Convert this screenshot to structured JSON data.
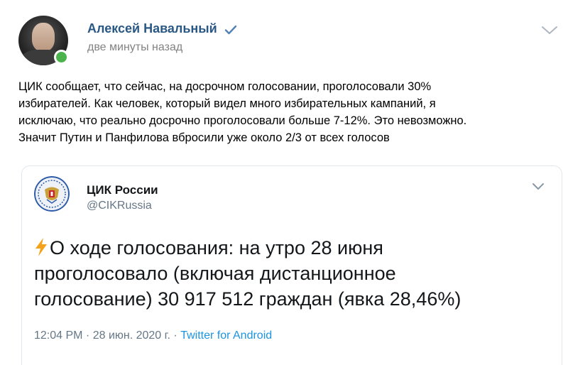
{
  "author": {
    "name": "Алексей Навальный",
    "time": "две минуты назад",
    "verified": true,
    "online": true
  },
  "post": {
    "text_lines": [
      "ЦИК сообщает, что сейчас, на досрочном голосовании, проголосовали 30%",
      "избирателей. Как человек, который видел много избирательных кампаний, я",
      "исключаю, что реально досрочно проголосовали больше 7-12%. Это невозможно.",
      "Значит Путин и Панфилова вбросили уже около 2/3 от всех голосов"
    ]
  },
  "tweet": {
    "name": "ЦИК России",
    "handle": "@CIKRussia",
    "text_lines": [
      "О ходе голосования: на утро 28 июня",
      "проголосовало (включая дистанционное",
      "голосование) 30 917 512 граждан (явка 28,46%)"
    ],
    "time": "12:04 PM · 28 июн. 2020 г. ·",
    "source": "Twitter for Android"
  },
  "icons": {
    "verified": "verified-check-icon",
    "menu": "chevron-down-icon",
    "emoji": "lightning-icon",
    "tweet_logo": "cik-emblem-icon"
  },
  "colors": {
    "author_link": "#2a5885",
    "muted": "#828282",
    "online": "#4bb34b",
    "twitter_link": "#1b95e0",
    "twitter_muted": "#657786",
    "lightning": "#f4a21c"
  }
}
